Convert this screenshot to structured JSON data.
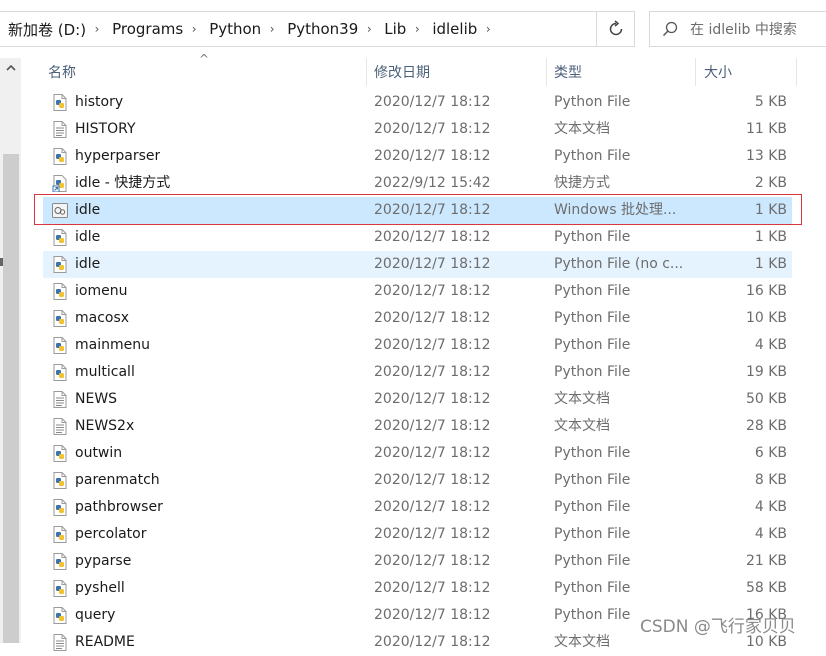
{
  "address": {
    "crumbs": [
      "新加卷 (D:)",
      "Programs",
      "Python",
      "Python39",
      "Lib",
      "idlelib"
    ],
    "refresh_icon": "refresh-icon"
  },
  "search": {
    "placeholder": "在 idlelib 中搜索",
    "icon": "search-icon"
  },
  "columns": {
    "name": "名称",
    "date": "修改日期",
    "type": "类型",
    "size": "大小"
  },
  "files": [
    {
      "name": "history",
      "date": "2020/12/7 18:12",
      "type": "Python File",
      "size": "5 KB",
      "icon": "python-file-icon"
    },
    {
      "name": "HISTORY",
      "date": "2020/12/7 18:12",
      "type": "文本文档",
      "size": "11 KB",
      "icon": "text-file-icon"
    },
    {
      "name": "hyperparser",
      "date": "2020/12/7 18:12",
      "type": "Python File",
      "size": "13 KB",
      "icon": "python-file-icon"
    },
    {
      "name": "idle - 快捷方式",
      "date": "2022/9/12 15:42",
      "type": "快捷方式",
      "size": "2 KB",
      "icon": "shortcut-icon"
    },
    {
      "name": "idle",
      "date": "2020/12/7 18:12",
      "type": "Windows 批处理...",
      "size": "1 KB",
      "icon": "batch-file-icon",
      "state": "selected"
    },
    {
      "name": "idle",
      "date": "2020/12/7 18:12",
      "type": "Python File",
      "size": "1 KB",
      "icon": "python-file-icon"
    },
    {
      "name": "idle",
      "date": "2020/12/7 18:12",
      "type": "Python File (no c...",
      "size": "1 KB",
      "icon": "python-file-icon",
      "state": "hover"
    },
    {
      "name": "iomenu",
      "date": "2020/12/7 18:12",
      "type": "Python File",
      "size": "16 KB",
      "icon": "python-file-icon"
    },
    {
      "name": "macosx",
      "date": "2020/12/7 18:12",
      "type": "Python File",
      "size": "10 KB",
      "icon": "python-file-icon"
    },
    {
      "name": "mainmenu",
      "date": "2020/12/7 18:12",
      "type": "Python File",
      "size": "4 KB",
      "icon": "python-file-icon"
    },
    {
      "name": "multicall",
      "date": "2020/12/7 18:12",
      "type": "Python File",
      "size": "19 KB",
      "icon": "python-file-icon"
    },
    {
      "name": "NEWS",
      "date": "2020/12/7 18:12",
      "type": "文本文档",
      "size": "50 KB",
      "icon": "text-file-icon"
    },
    {
      "name": "NEWS2x",
      "date": "2020/12/7 18:12",
      "type": "文本文档",
      "size": "28 KB",
      "icon": "text-file-icon"
    },
    {
      "name": "outwin",
      "date": "2020/12/7 18:12",
      "type": "Python File",
      "size": "6 KB",
      "icon": "python-file-icon"
    },
    {
      "name": "parenmatch",
      "date": "2020/12/7 18:12",
      "type": "Python File",
      "size": "8 KB",
      "icon": "python-file-icon"
    },
    {
      "name": "pathbrowser",
      "date": "2020/12/7 18:12",
      "type": "Python File",
      "size": "4 KB",
      "icon": "python-file-icon"
    },
    {
      "name": "percolator",
      "date": "2020/12/7 18:12",
      "type": "Python File",
      "size": "4 KB",
      "icon": "python-file-icon"
    },
    {
      "name": "pyparse",
      "date": "2020/12/7 18:12",
      "type": "Python File",
      "size": "21 KB",
      "icon": "python-file-icon"
    },
    {
      "name": "pyshell",
      "date": "2020/12/7 18:12",
      "type": "Python File",
      "size": "58 KB",
      "icon": "python-file-icon"
    },
    {
      "name": "query",
      "date": "2020/12/7 18:12",
      "type": "Python File",
      "size": "16 KB",
      "icon": "python-file-icon"
    },
    {
      "name": "README",
      "date": "2020/12/7 18:12",
      "type": "文本文档",
      "size": "10 KB",
      "icon": "text-file-icon"
    }
  ],
  "watermark": "CSDN @飞行家贝贝",
  "colors": {
    "selected_bg": "#cce8ff",
    "hover_bg": "#e5f3ff",
    "highlight_border": "#d9363e",
    "header_text": "#4c607a",
    "secondary_text": "#6d6d6d"
  }
}
